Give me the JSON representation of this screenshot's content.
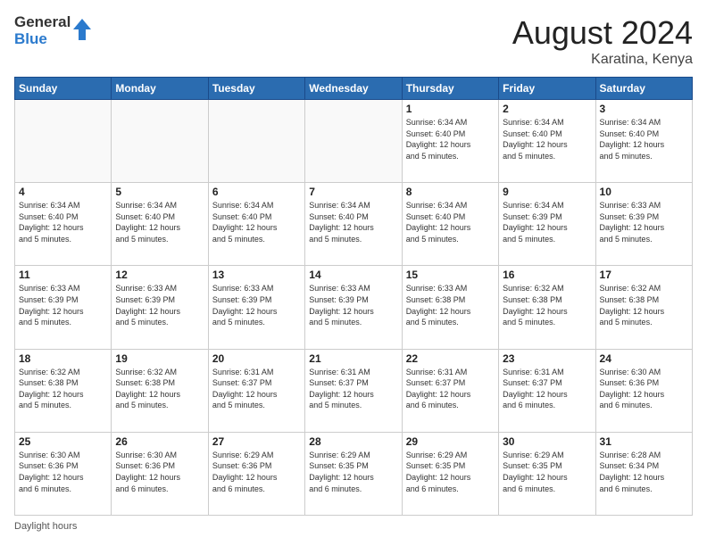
{
  "logo": {
    "general": "General",
    "blue": "Blue"
  },
  "header": {
    "month_year": "August 2024",
    "location": "Karatina, Kenya"
  },
  "days_of_week": [
    "Sunday",
    "Monday",
    "Tuesday",
    "Wednesday",
    "Thursday",
    "Friday",
    "Saturday"
  ],
  "footer": {
    "daylight_label": "Daylight hours"
  },
  "weeks": [
    [
      {
        "day": "",
        "info": ""
      },
      {
        "day": "",
        "info": ""
      },
      {
        "day": "",
        "info": ""
      },
      {
        "day": "",
        "info": ""
      },
      {
        "day": "1",
        "info": "Sunrise: 6:34 AM\nSunset: 6:40 PM\nDaylight: 12 hours\nand 5 minutes."
      },
      {
        "day": "2",
        "info": "Sunrise: 6:34 AM\nSunset: 6:40 PM\nDaylight: 12 hours\nand 5 minutes."
      },
      {
        "day": "3",
        "info": "Sunrise: 6:34 AM\nSunset: 6:40 PM\nDaylight: 12 hours\nand 5 minutes."
      }
    ],
    [
      {
        "day": "4",
        "info": "Sunrise: 6:34 AM\nSunset: 6:40 PM\nDaylight: 12 hours\nand 5 minutes."
      },
      {
        "day": "5",
        "info": "Sunrise: 6:34 AM\nSunset: 6:40 PM\nDaylight: 12 hours\nand 5 minutes."
      },
      {
        "day": "6",
        "info": "Sunrise: 6:34 AM\nSunset: 6:40 PM\nDaylight: 12 hours\nand 5 minutes."
      },
      {
        "day": "7",
        "info": "Sunrise: 6:34 AM\nSunset: 6:40 PM\nDaylight: 12 hours\nand 5 minutes."
      },
      {
        "day": "8",
        "info": "Sunrise: 6:34 AM\nSunset: 6:40 PM\nDaylight: 12 hours\nand 5 minutes."
      },
      {
        "day": "9",
        "info": "Sunrise: 6:34 AM\nSunset: 6:39 PM\nDaylight: 12 hours\nand 5 minutes."
      },
      {
        "day": "10",
        "info": "Sunrise: 6:33 AM\nSunset: 6:39 PM\nDaylight: 12 hours\nand 5 minutes."
      }
    ],
    [
      {
        "day": "11",
        "info": "Sunrise: 6:33 AM\nSunset: 6:39 PM\nDaylight: 12 hours\nand 5 minutes."
      },
      {
        "day": "12",
        "info": "Sunrise: 6:33 AM\nSunset: 6:39 PM\nDaylight: 12 hours\nand 5 minutes."
      },
      {
        "day": "13",
        "info": "Sunrise: 6:33 AM\nSunset: 6:39 PM\nDaylight: 12 hours\nand 5 minutes."
      },
      {
        "day": "14",
        "info": "Sunrise: 6:33 AM\nSunset: 6:39 PM\nDaylight: 12 hours\nand 5 minutes."
      },
      {
        "day": "15",
        "info": "Sunrise: 6:33 AM\nSunset: 6:38 PM\nDaylight: 12 hours\nand 5 minutes."
      },
      {
        "day": "16",
        "info": "Sunrise: 6:32 AM\nSunset: 6:38 PM\nDaylight: 12 hours\nand 5 minutes."
      },
      {
        "day": "17",
        "info": "Sunrise: 6:32 AM\nSunset: 6:38 PM\nDaylight: 12 hours\nand 5 minutes."
      }
    ],
    [
      {
        "day": "18",
        "info": "Sunrise: 6:32 AM\nSunset: 6:38 PM\nDaylight: 12 hours\nand 5 minutes."
      },
      {
        "day": "19",
        "info": "Sunrise: 6:32 AM\nSunset: 6:38 PM\nDaylight: 12 hours\nand 5 minutes."
      },
      {
        "day": "20",
        "info": "Sunrise: 6:31 AM\nSunset: 6:37 PM\nDaylight: 12 hours\nand 5 minutes."
      },
      {
        "day": "21",
        "info": "Sunrise: 6:31 AM\nSunset: 6:37 PM\nDaylight: 12 hours\nand 5 minutes."
      },
      {
        "day": "22",
        "info": "Sunrise: 6:31 AM\nSunset: 6:37 PM\nDaylight: 12 hours\nand 6 minutes."
      },
      {
        "day": "23",
        "info": "Sunrise: 6:31 AM\nSunset: 6:37 PM\nDaylight: 12 hours\nand 6 minutes."
      },
      {
        "day": "24",
        "info": "Sunrise: 6:30 AM\nSunset: 6:36 PM\nDaylight: 12 hours\nand 6 minutes."
      }
    ],
    [
      {
        "day": "25",
        "info": "Sunrise: 6:30 AM\nSunset: 6:36 PM\nDaylight: 12 hours\nand 6 minutes."
      },
      {
        "day": "26",
        "info": "Sunrise: 6:30 AM\nSunset: 6:36 PM\nDaylight: 12 hours\nand 6 minutes."
      },
      {
        "day": "27",
        "info": "Sunrise: 6:29 AM\nSunset: 6:36 PM\nDaylight: 12 hours\nand 6 minutes."
      },
      {
        "day": "28",
        "info": "Sunrise: 6:29 AM\nSunset: 6:35 PM\nDaylight: 12 hours\nand 6 minutes."
      },
      {
        "day": "29",
        "info": "Sunrise: 6:29 AM\nSunset: 6:35 PM\nDaylight: 12 hours\nand 6 minutes."
      },
      {
        "day": "30",
        "info": "Sunrise: 6:29 AM\nSunset: 6:35 PM\nDaylight: 12 hours\nand 6 minutes."
      },
      {
        "day": "31",
        "info": "Sunrise: 6:28 AM\nSunset: 6:34 PM\nDaylight: 12 hours\nand 6 minutes."
      }
    ]
  ]
}
